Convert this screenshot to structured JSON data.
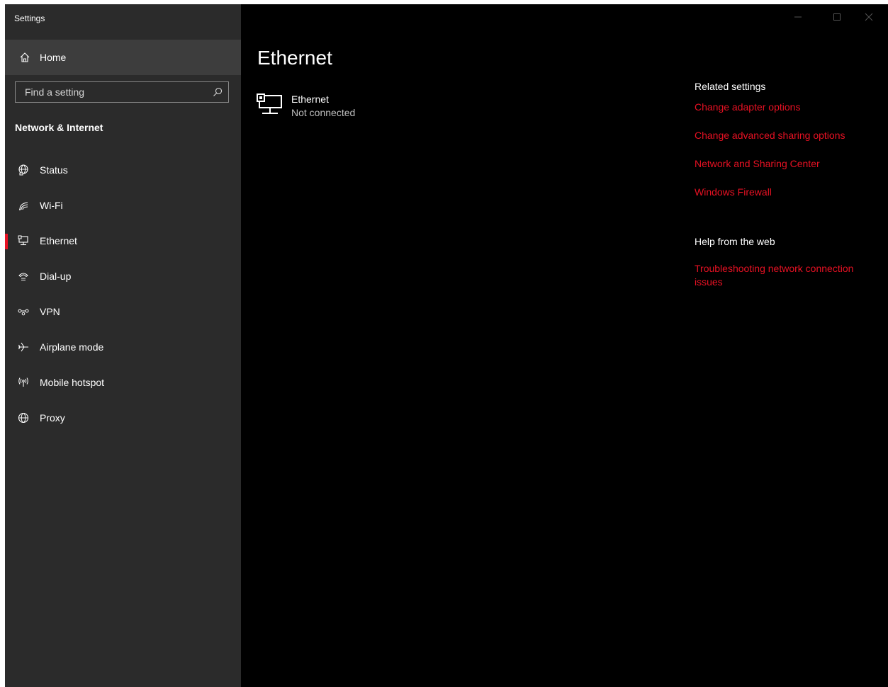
{
  "window": {
    "title": "Settings"
  },
  "sidebar": {
    "home_label": "Home",
    "search_placeholder": "Find a setting",
    "section_title": "Network & Internet",
    "items": [
      {
        "label": "Status",
        "icon": "globe-status-icon"
      },
      {
        "label": "Wi-Fi",
        "icon": "wifi-icon"
      },
      {
        "label": "Ethernet",
        "icon": "ethernet-icon",
        "selected": true
      },
      {
        "label": "Dial-up",
        "icon": "dialup-icon"
      },
      {
        "label": "VPN",
        "icon": "vpn-icon"
      },
      {
        "label": "Airplane mode",
        "icon": "airplane-icon"
      },
      {
        "label": "Mobile hotspot",
        "icon": "hotspot-icon"
      },
      {
        "label": "Proxy",
        "icon": "globe-icon"
      }
    ]
  },
  "main": {
    "page_title": "Ethernet",
    "adapter": {
      "name": "Ethernet",
      "status": "Not connected"
    }
  },
  "related": {
    "heading": "Related settings",
    "links": [
      "Change adapter options",
      "Change advanced sharing options",
      "Network and Sharing Center",
      "Windows Firewall"
    ]
  },
  "help": {
    "heading": "Help from the web",
    "links": [
      "Troubleshooting network connection issues"
    ]
  },
  "colors": {
    "accent": "#e81123",
    "sidebar_bg": "#2b2b2b",
    "content_bg": "#000000"
  }
}
